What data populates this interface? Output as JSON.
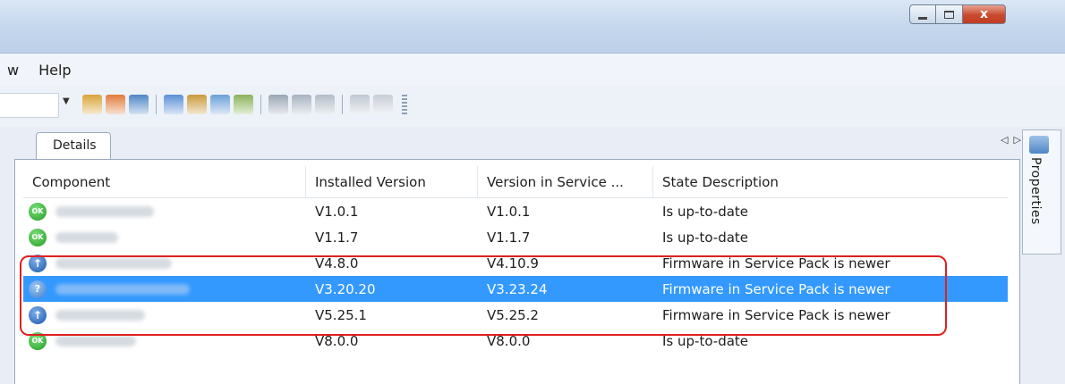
{
  "window": {
    "close_label": "x"
  },
  "menu": {
    "items": [
      "w",
      "Help"
    ]
  },
  "toolbar": {
    "icons": [
      "tool-icon",
      "tool-icon",
      "tool-icon",
      "tool-icon",
      "tool-icon",
      "tool-icon",
      "tool-icon",
      "tool-icon",
      "tool-icon",
      "tool-icon",
      "tool-icon",
      "tool-icon"
    ]
  },
  "tab": {
    "label": "Details"
  },
  "side_panel": {
    "label": "Properties"
  },
  "table": {
    "headers": [
      "Component",
      "Installed Version",
      "Version in Service ...",
      "State Description"
    ],
    "rows": [
      {
        "status": "ok",
        "installed": "V1.0.1",
        "service": "V1.0.1",
        "state": "Is up-to-date"
      },
      {
        "status": "ok",
        "installed": "V1.1.7",
        "service": "V1.1.7",
        "state": "Is up-to-date"
      },
      {
        "status": "up",
        "installed": "V4.8.0",
        "service": "V4.10.9",
        "state": "Firmware in Service Pack is newer"
      },
      {
        "status": "q",
        "installed": "V3.20.20",
        "service": "V3.23.24",
        "state": "Firmware in Service Pack is newer"
      },
      {
        "status": "up",
        "installed": "V5.25.1",
        "service": "V5.25.2",
        "state": "Firmware in Service Pack is newer"
      },
      {
        "status": "ok",
        "installed": "V8.0.0",
        "service": "V8.0.0",
        "state": "Is up-to-date"
      }
    ]
  },
  "colors": {
    "selection": "#3399ff",
    "highlight": "#e02020",
    "ok": "#1f9a1f",
    "update": "#1a56a8"
  }
}
